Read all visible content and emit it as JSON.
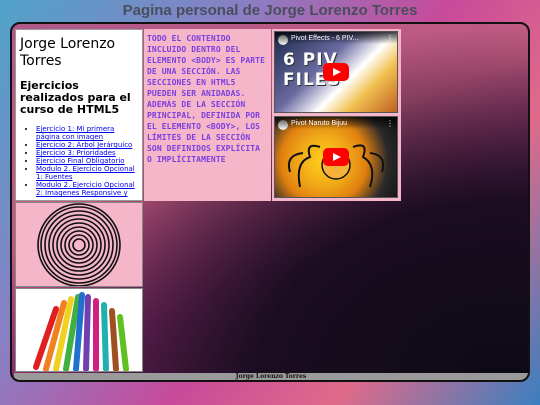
{
  "page": {
    "title": "Pagina personal de Jorge Lorenzo Torres"
  },
  "intro": {
    "name": "Jorge Lorenzo Torres",
    "subtitle": "Ejercicios realizados para el curso de HTML5",
    "links": [
      "Ejercicio 1: Mi primera página con imagen",
      "Ejercicio 2: Árbol Jerárquico",
      "Ejercicio 3: Prioridades",
      "Ejercicio Final Obligatorio",
      "Modulo 2. Ejercicio Opcional 1: Fuentes",
      "Modulo 2. Ejercicio Opcional 2: Imagenes Responsive y"
    ]
  },
  "note": {
    "text": "Todo el contenido incluido dentro del elemento <body> es parte de una sección. Las secciones en HTML5 pueden ser anidadas. Además de la sección principal, definida por el elemento <body>, los límites de la sección son definidos explícita o implícitamente"
  },
  "videos": [
    {
      "title": "Pivot Effects - 6 PIV...",
      "banner": "6 PIV FILES",
      "icon": "youtube-play-icon"
    },
    {
      "title": "Pivot Naruto Bijuu",
      "icon": "youtube-play-icon"
    }
  ],
  "footer": {
    "text": "Jorge Lorenzo Torres"
  },
  "colors": {
    "accent_text": "#7b3fe0",
    "panel_pink": "#f4b6c8",
    "footer_bar": "#9a9a9a"
  }
}
